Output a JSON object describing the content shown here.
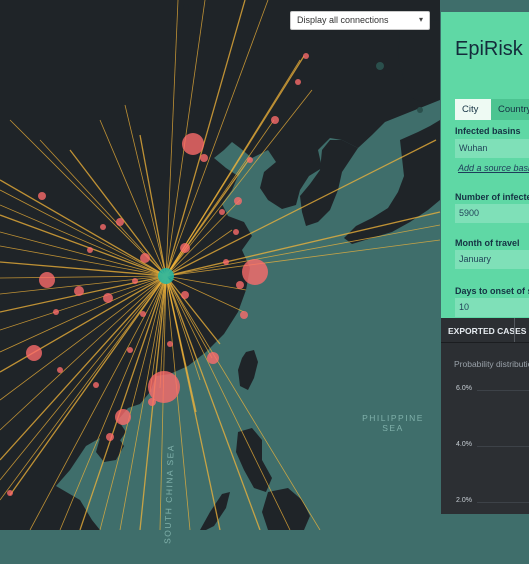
{
  "map": {
    "connections_select": "Display all connections",
    "sea_labels": {
      "philippine": [
        "PHILIPPINE",
        "SEA"
      ],
      "south_china": "SOUTH CHINA SEA"
    }
  },
  "panel": {
    "title": "EpiRisk",
    "tabs": [
      "City",
      "Country"
    ],
    "fields": {
      "infected_basins": {
        "label": "Infected basins",
        "value": "Wuhan",
        "add_link": "Add a source basin"
      },
      "infected_count": {
        "label": "Number of infected",
        "value": "5900"
      },
      "month": {
        "label": "Month of travel",
        "value": "January"
      },
      "days_onset": {
        "label": "Days to onset of symptoms",
        "value": "10"
      }
    }
  },
  "exported": {
    "heading": "EXPORTED CASES",
    "subtitle": "Probability distribution",
    "y_ticks": [
      "6.0%",
      "4.0%",
      "2.0%"
    ]
  },
  "colors": {
    "ocean": "#3f6e6b",
    "land": "#1f2428",
    "connection": "#f4b53a",
    "bubble": "#ff6b6b",
    "panel": "#5fd8a5",
    "dark_panel": "#2c2f33"
  }
}
